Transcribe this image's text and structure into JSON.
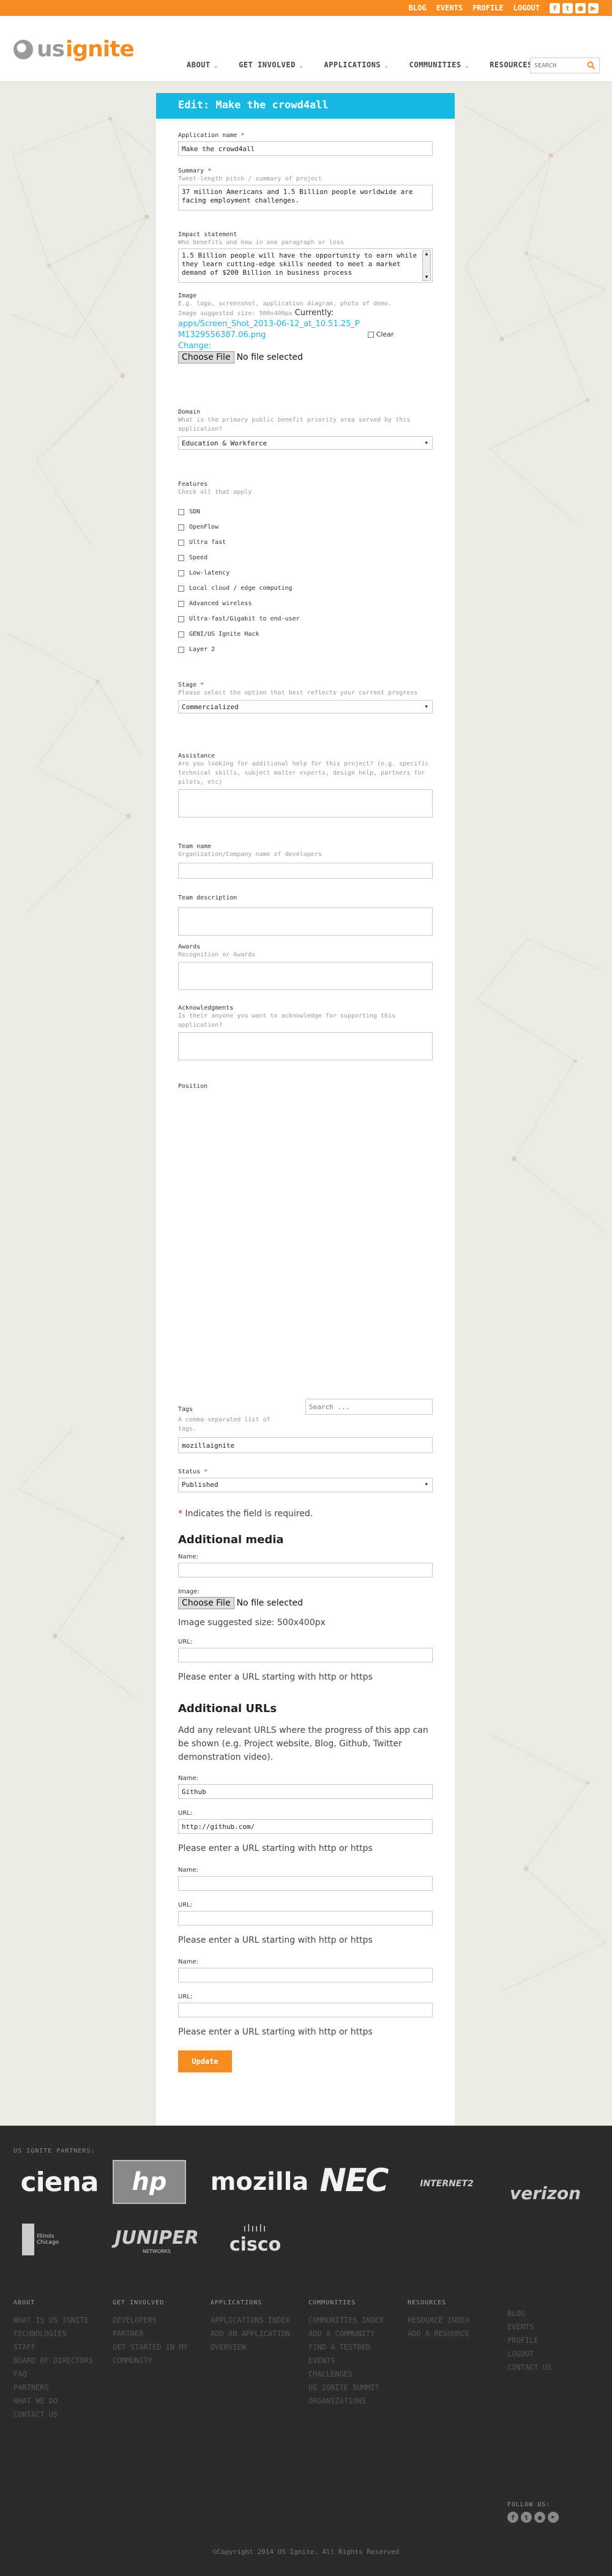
{
  "topbar": {
    "links": [
      "BLOG",
      "EVENTS",
      "PROFILE",
      "LOGOUT"
    ],
    "social_icons": [
      "facebook-icon",
      "twitter-icon",
      "flickr-icon",
      "youtube-icon"
    ]
  },
  "header": {
    "logo": {
      "us": "us",
      "ignite": "ignite"
    },
    "nav": [
      "ABOUT",
      "GET INVOLVED",
      "APPLICATIONS",
      "COMMUNITIES",
      "RESOURCES"
    ],
    "search_placeholder": "SEARCH"
  },
  "colors": {
    "accent": "#f68b1f",
    "title_bar": "#17b8e2",
    "footer": "#2b2b2b"
  },
  "form": {
    "title": "Edit: Make the crowd4all",
    "app_name": {
      "label": "Application name",
      "value": "Make the crowd4all"
    },
    "summary": {
      "label": "Summary",
      "help": "Tweet-length pitch / summary of project",
      "value": "37 million Americans and 1.5 Billion people worldwide are facing employment challenges."
    },
    "impact": {
      "label": "Impact statement",
      "help": "Who benefits and how in one paragraph or less",
      "value": "1.5 Billion people will have the opportunity to earn while they learn cutting-edge skills needed to meet a market demand of $200 Billion in business process"
    },
    "image": {
      "label": "Image",
      "help1": "E.g. logo, screenshot, application diagram, photo of demo.",
      "help2": "Image suggested size: 500x400px",
      "currently": "Currently:",
      "filename": "apps/Screen_Shot_2013-06-12_at_10.51.25_PM1329556387.06.png",
      "clear": "Clear",
      "change": "Change:",
      "choose": "Choose File",
      "no_file": "No file selected"
    },
    "domain": {
      "label": "Domain",
      "help": "What is the primary public benefit priority area served by this application?",
      "value": "Education & Workforce"
    },
    "features": {
      "label": "Features",
      "help": "Check all that apply",
      "items": [
        "SDN",
        "OpenFlow",
        "Ultra fast",
        "Speed",
        "Low-latency",
        "Local cloud / edge computing",
        "Advanced wireless",
        "Ultra-fast/Gigabit to end-user",
        "GENI/US Ignite Hack",
        "Layer 2"
      ]
    },
    "stage": {
      "label": "Stage",
      "help": "Please select the option that best reflects your current progress",
      "value": "Commercialized"
    },
    "assistance": {
      "label": "Assistance",
      "help": "Are you looking for additional help for this project? (e.g. specific technical skills, subject matter experts, design help, partners for pilots, etc)"
    },
    "team_name": {
      "label": "Team name",
      "help": "Organization/Company name of developers"
    },
    "team_description": {
      "label": "Team description"
    },
    "awards": {
      "label": "Awards",
      "help": "Recognition or Awards"
    },
    "acknowledgments": {
      "label": "Acknowledgments",
      "help": "Is their anyone you want to acknowledge for supporting this application?"
    },
    "position": {
      "label": "Position"
    },
    "tags": {
      "label": "Tags",
      "search_placeholder": "Search ...",
      "help": "A comma-separated list of tags.",
      "value": "mozillaignite"
    },
    "status": {
      "label": "Status",
      "value": "Published"
    },
    "required_note": "Indicates the field is required.",
    "media": {
      "title": "Additional media",
      "name_label": "Name:",
      "image_label": "Image:",
      "choose": "Choose File",
      "no_file": "No file selected",
      "image_help": "Image suggested size: 500x400px",
      "url_label": "URL:",
      "url_help": "Please enter a URL starting with http or https"
    },
    "urls": {
      "title": "Additional URLs",
      "help": "Add any relevant URLS where the progress of this app can be shown (e.g. Project website, Blog, Github, Twitter demonstration video).",
      "name_label": "Name:",
      "url_label": "URL:",
      "url_help": "Please enter a URL starting with http or https",
      "entries": [
        {
          "name": "Github",
          "url": "http://github.com/"
        },
        {
          "name": "",
          "url": ""
        },
        {
          "name": "",
          "url": ""
        }
      ]
    },
    "update": "Update"
  },
  "footer": {
    "partners_title": "US IGNITE PARTNERS:",
    "partners": [
      "ciena",
      "hp",
      "mozilla",
      "NEC",
      "INTERNET2",
      "verizon",
      "Illinois",
      "JUNIPER",
      "cisco"
    ],
    "juniper_sub": "NETWORKS",
    "illinois_lines": [
      "Illinois",
      "Chicago"
    ],
    "columns": [
      {
        "title": "ABOUT",
        "links": [
          "WHAT IS US IGNITE",
          "TECHNOLOGIES",
          "STAFF",
          "BOARD OF DIRECTORS",
          "FAQ",
          "PARTNERS",
          "WHAT WE DO",
          "CONTACT US"
        ]
      },
      {
        "title": "GET INVOLVED",
        "links": [
          "DEVELOPERS",
          "PARTNER",
          "GET STARTED IN MY COMMUNITY"
        ]
      },
      {
        "title": "APPLICATIONS",
        "links": [
          "APPLICATIONS INDEX",
          "ADD AN APPLICATION",
          "OVERVIEW"
        ]
      },
      {
        "title": "COMMUNITIES",
        "links": [
          "COMMUNITIES INDEX",
          "ADD A COMMUNITY",
          "FIND A TESTBED",
          "EVENTS",
          "CHALLENGES",
          "US IGNITE SUMMIT",
          "ORGANIZATIONS"
        ]
      },
      {
        "title": "RESOURCES",
        "links": [
          "RESOURCE INDEX",
          "ADD A RESOURCE"
        ]
      },
      {
        "title": "",
        "links": [
          "BLOG",
          "EVENTS",
          "PROFILE",
          "LOGOUT",
          "CONTACT US"
        ]
      }
    ],
    "follow": "FOLLOW US:",
    "copyright": "©Copyright 2014 US Ignite. All Rights Reserved"
  }
}
